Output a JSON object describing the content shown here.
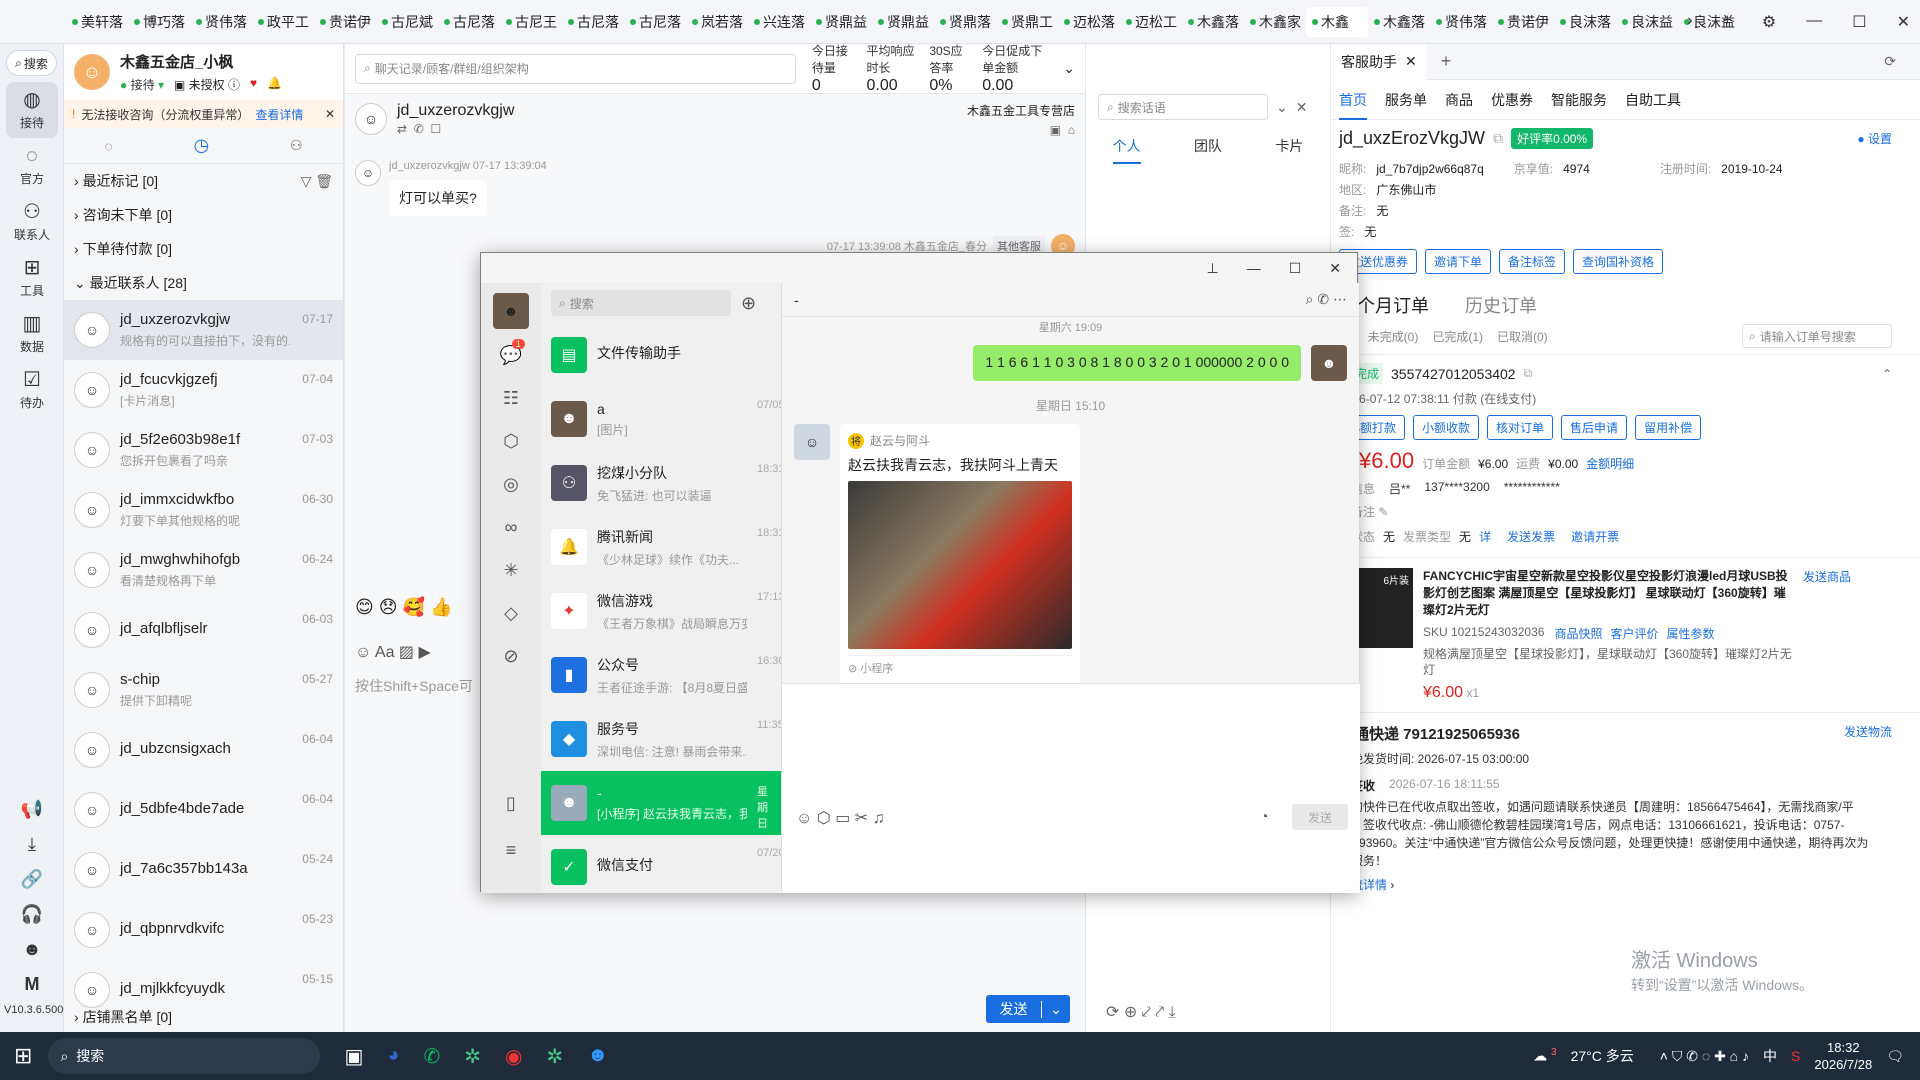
{
  "top_tabs": [
    "美轩落",
    "博巧落",
    "贤伟落",
    "政平工",
    "贵诺伊",
    "古尼斌",
    "古尼落",
    "古尼王",
    "古尼落",
    "古尼落",
    "岚若落",
    "兴连落",
    "贤鼎益",
    "贤鼎益",
    "贤鼎落",
    "贤鼎工",
    "迈松落",
    "迈松工",
    "木鑫落",
    "木鑫家",
    "木鑫",
    "木鑫落",
    "贤伟落",
    "贵诺伊",
    "良沫落",
    "良沫益",
    "良沫益"
  ],
  "rail": [
    {
      "label": "接待",
      "icon": "chat-bubble-icon"
    },
    {
      "label": "官方",
      "icon": "official-icon"
    },
    {
      "label": "联系人",
      "icon": "contacts-icon"
    },
    {
      "label": "工具",
      "icon": "tools-icon"
    },
    {
      "label": "数据",
      "icon": "data-icon"
    },
    {
      "label": "待办",
      "icon": "todo-icon"
    }
  ],
  "rail_search": "搜索",
  "version": "V10.3.6.500",
  "profile": {
    "name": "木鑫五金店_小枫",
    "status": "接待",
    "auth": "未授权"
  },
  "warning": {
    "text": "无法接收咨询（分流权重异常）",
    "link": "查看详情"
  },
  "sections": {
    "marked": "最近标记 [0]",
    "no_order": "咨询未下单 [0]",
    "pending": "下单待付款 [0]",
    "recent": "最近联系人 [28]",
    "blacklist": "店铺黑名单 [0]"
  },
  "contacts": [
    {
      "name": "jd_uxzerozvkgjw",
      "msg": "规格有的可以直接拍下，没有的...",
      "date": "07-17"
    },
    {
      "name": "jd_fcucvkjgzefj",
      "msg": "[卡片消息]",
      "date": "07-04"
    },
    {
      "name": "jd_5f2e603b98e1f",
      "msg": "您拆开包裹看了吗亲",
      "date": "07-03"
    },
    {
      "name": "jd_immxcidwkfbo",
      "msg": "灯要下单其他规格的呢",
      "date": "06-30"
    },
    {
      "name": "jd_mwghwhihofgb",
      "msg": "看清楚规格再下单",
      "date": "06-24"
    },
    {
      "name": "jd_afqlbfljselr",
      "msg": "",
      "date": "06-03"
    },
    {
      "name": "s-chip",
      "msg": "提供下卸精呢",
      "date": "05-27"
    },
    {
      "name": "jd_ubzcnsigxach",
      "msg": "",
      "date": "06-04"
    },
    {
      "name": "jd_5dbfe4bde7ade",
      "msg": "",
      "date": "06-04"
    },
    {
      "name": "jd_7a6c357bb143a",
      "msg": "",
      "date": "05-24"
    },
    {
      "name": "jd_qbpnrvdkvifc",
      "msg": "",
      "date": "05-23"
    },
    {
      "name": "jd_mjlkkfcyuydk",
      "msg": "",
      "date": "05-15"
    }
  ],
  "chat": {
    "search_placeholder": "聊天记录/顾客/群组/组织架构",
    "stats": [
      {
        "label": "今日接待量",
        "value": "0"
      },
      {
        "label": "平均响应时长",
        "value": "0.00"
      },
      {
        "label": "30S应答率",
        "value": "0%"
      },
      {
        "label": "今日促成下单金额",
        "value": "0.00"
      }
    ],
    "customer": "jd_uxzerozvkgjw",
    "shop_tag": "木鑫五金工具专营店",
    "msg_meta": "jd_uxzerozvkgjw  07-17 13:39:04",
    "msg_text": "灯可以单买?",
    "reply_meta": "07-17 13:39:08  木鑫五金店_春分",
    "reply_tag": "其他客服",
    "input_placeholder": "按住Shift+Space可",
    "send": "发送"
  },
  "smart": {
    "search_placeholder": "搜索话语",
    "tabs": [
      "个人",
      "团队",
      "卡片"
    ]
  },
  "cs": {
    "title": "客服助手",
    "nav": [
      "首页",
      "服务单",
      "商品",
      "优惠券",
      "智能服务",
      "自助工具"
    ],
    "settings": "设置",
    "user": "jd_uxzErozVkgJW",
    "good_rate": "好评率0.00%",
    "nickname_label": "昵称:",
    "nickname": "jd_7b7djp2w66q87q",
    "jxz_label": "京享值:",
    "jxz": "4974",
    "reg_label": "注册时间:",
    "reg": "2019-10-24",
    "area_label": "地区:",
    "area": "广东佛山市",
    "note_label": "备注:",
    "note": "无",
    "extra_label": "签:",
    "extra": "无",
    "btns": [
      "发送优惠券",
      "邀请下单",
      "备注标签",
      "查询国补资格"
    ],
    "order_tabs": [
      "三个月订单",
      "历史订单"
    ],
    "order_filters": [
      "(1)",
      "未完成(0)",
      "已完成(1)",
      "已取消(0)"
    ],
    "order_search": "请输入订单号搜索",
    "order_status": "已完成",
    "order_id": "3557427012053402",
    "order_time": "2026-07-12 07:38:11 付款 (在线支付)",
    "order_actions": [
      "小额打款",
      "小额收款",
      "核对订单",
      "售后申请",
      "留用补偿"
    ],
    "paid_label": "付",
    "paid": "¥6.00",
    "amount_label": "订单金额",
    "amount": "¥6.00",
    "freight_label": "运费",
    "freight": "¥0.00",
    "amount_detail": "金额明细",
    "recv_label": "货信息",
    "recv_name": "吕**",
    "recv_phone": "137****3200",
    "recv_addr": "************",
    "remark_label": "家备注",
    "invoice_label": "票状态",
    "invoice": "无",
    "invoice_type_label": "发票类型",
    "invoice_type": "无",
    "invoice_detail": "详",
    "send_invoice": "发送发票",
    "invite_invoice": "邀请开票",
    "product_badge": "6片装",
    "product_name": "FANCYCHIC宇宙星空新款星空投影仪星空投影灯浪漫led月球USB投影灯创艺图案 满屋顶星空【星球投影灯】 星球联动灯【360旋转】璀璨灯2片无灯",
    "send_product": "发送商品",
    "sku": "SKU 10215243032036",
    "sku_links": [
      "商品快照",
      "客户评价",
      "属性参数"
    ],
    "spec": "规格满屋顶星空【星球投影灯】，星球联动灯【360旋转】璀璨灯2片无灯",
    "price": "¥6.00",
    "qty": "x1",
    "express": "中通快递 79121925065936",
    "send_logistics": "发送物流",
    "latest_ship": "最晚发货时间:  2026-07-15 03:00:00",
    "signed": "已签收",
    "signed_time": "2026-07-16 18:11:55",
    "log_text": "您的快件已在代收点取出签收，如遇问题请联系快递员【周建明：18566475464】，无需找商家/平台。签收代收点: -佛山顺德伦教碧桂园璞湾1号店，网点电话：13106661621，投诉电话：0757-22193960。关注“中通快递”官方微信公众号反馈问题，处理更快捷！感谢使用中通快递，期待再次为您服务！",
    "log_detail": "物流详情",
    "activate_title": "激活 Windows",
    "activate_sub": "转到“设置”以激活 Windows。"
  },
  "wechat": {
    "search_placeholder": "搜索",
    "chat_title": "-",
    "unread": "1",
    "chats": [
      {
        "name": "文件传输助手",
        "msg": "",
        "time": "",
        "color": "#07c160",
        "icon": "folder-icon"
      },
      {
        "name": "a",
        "msg": "[图片]",
        "time": "07/05",
        "color": "#6b5a4a",
        "icon": "avatar-icon"
      },
      {
        "name": "挖煤小分队",
        "msg": "免飞猛进: 也可以装逼",
        "time": "18:31",
        "color": "#556",
        "icon": "group-icon"
      },
      {
        "name": "腾讯新闻",
        "msg": "《少林足球》续作《功夫...",
        "time": "18:31",
        "color": "#fff",
        "icon": "news-icon"
      },
      {
        "name": "微信游戏",
        "msg": "《王者万象棋》战局瞬息万变...",
        "time": "17:13",
        "color": "#fff",
        "icon": "game-icon"
      },
      {
        "name": "公众号",
        "msg": "王者征途手游: 【8月8夏日盛...",
        "time": "16:30",
        "color": "#1e6fe0",
        "icon": "official-account-icon"
      },
      {
        "name": "服务号",
        "msg": "深圳电信: 注意! 暴雨会带来...",
        "time": "11:35",
        "color": "#1e8fe0",
        "icon": "service-icon"
      },
      {
        "name": "-",
        "msg": "[小程序] 赵云扶我青云志，我...",
        "time": "星期日",
        "color": "#9ab",
        "icon": "avatar-icon"
      },
      {
        "name": "微信支付",
        "msg": "",
        "time": "07/20",
        "color": "#07c160",
        "icon": "pay-icon"
      }
    ],
    "prev_time": "星期六 19:09",
    "sent_number": "1 1 6 6 1 1 0 3 0 8 1 8 0 0 3 2 0 1 000000 2 0 0 0",
    "time2": "星期日 15:10",
    "card_from": "赵云与阿斗",
    "card_title": "赵云扶我青云志，我扶阿斗上青天",
    "card_foot": "小程序",
    "send": "发送"
  },
  "taskbar": {
    "search": "搜索",
    "weather": "27°C 多云",
    "time": "18:32",
    "date": "2026/7/28",
    "lang": "中",
    "weather_badge": "3"
  }
}
